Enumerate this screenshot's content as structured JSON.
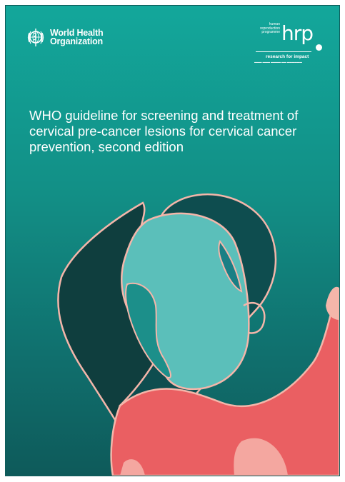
{
  "publisher": {
    "name_line1": "World Health",
    "name_line2": "Organization",
    "emblem_icon": "who-emblem-icon"
  },
  "partner": {
    "small_line1": "human",
    "small_line2": "reproduction",
    "small_line3": "programme",
    "wordmark": "hrp",
    "tagline": "research for impact"
  },
  "cover": {
    "title": "WHO guideline for screening and treatment of cervical pre-cancer lesions for cervical cancer prevention, second edition"
  },
  "colors": {
    "teal_bg": "#13a79b",
    "dark_teal": "#0e4d4f",
    "deep_green": "#0f3e3e",
    "face": "#5bbfba",
    "coral": "#ea5f62",
    "pink_outline": "#f4b6aa"
  }
}
